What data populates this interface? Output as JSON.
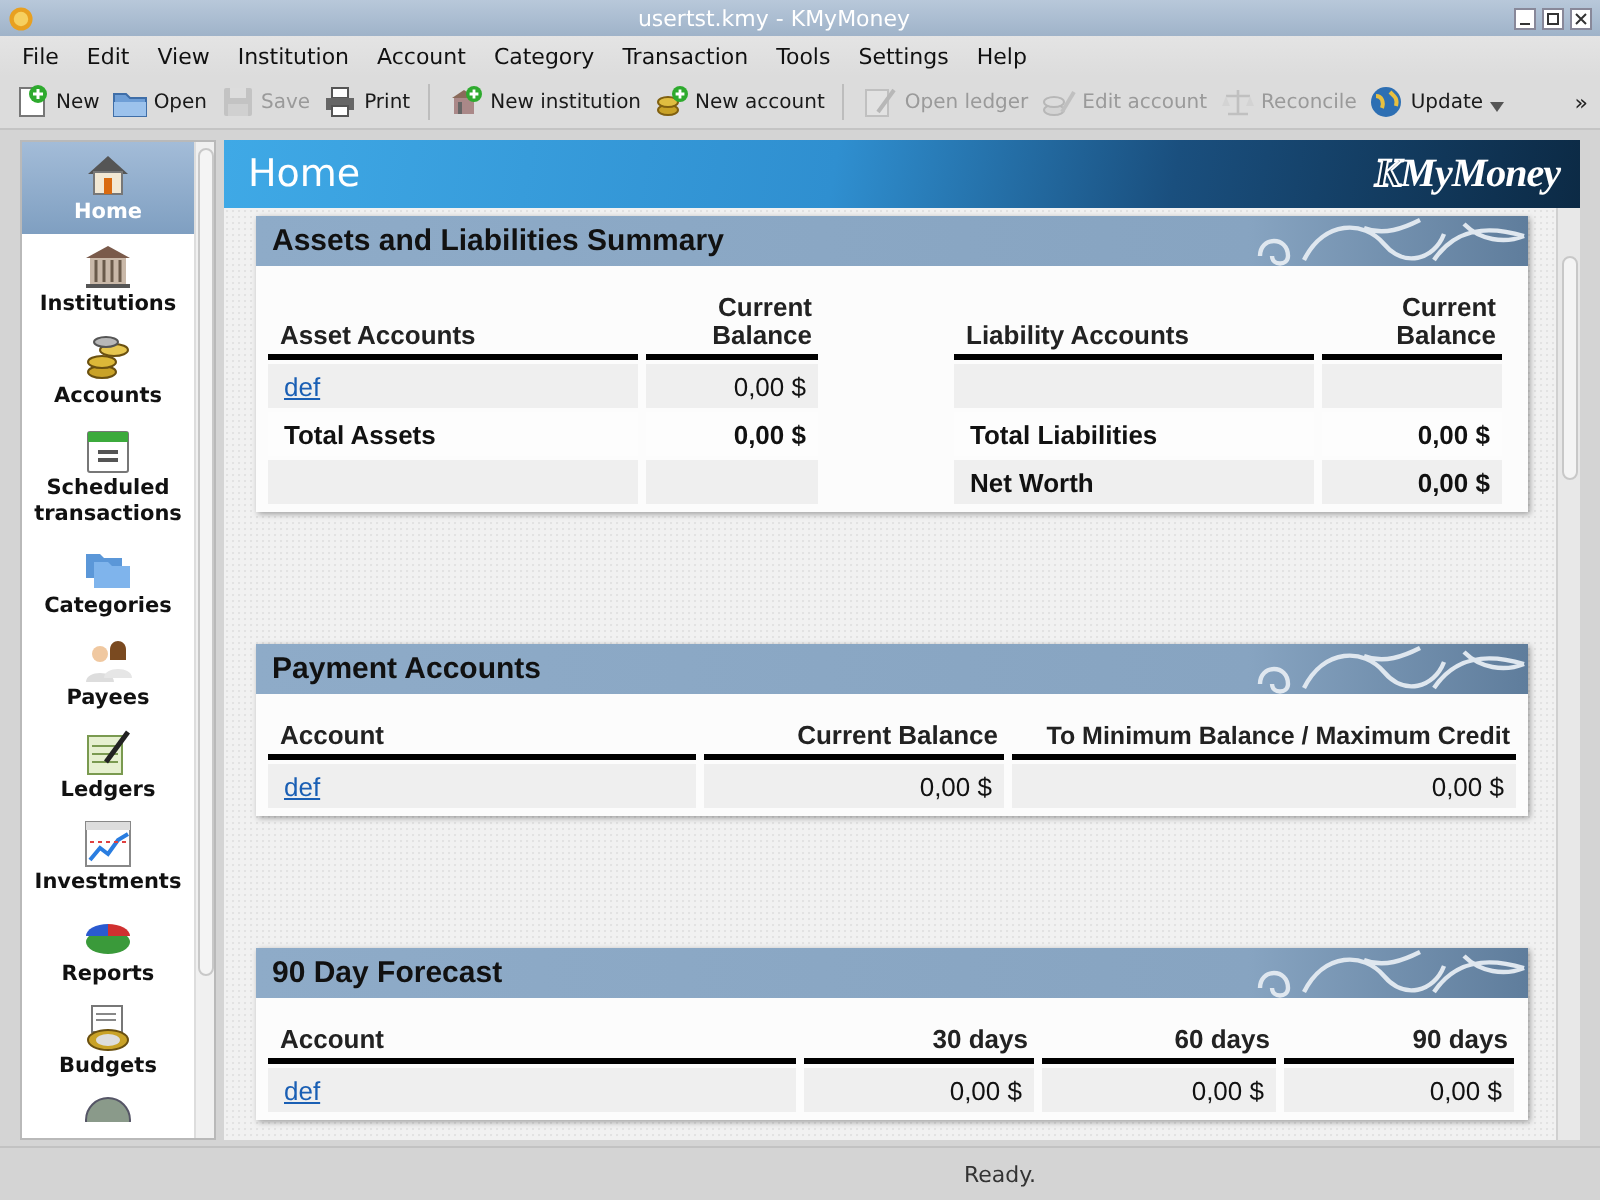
{
  "window": {
    "title": "usertst.kmy - KMyMoney"
  },
  "menu": [
    "File",
    "Edit",
    "View",
    "Institution",
    "Account",
    "Category",
    "Transaction",
    "Tools",
    "Settings",
    "Help"
  ],
  "toolbar": {
    "items": [
      {
        "kind": "button",
        "label": "New",
        "disabled": false
      },
      {
        "kind": "button",
        "label": "Open",
        "disabled": false
      },
      {
        "kind": "button",
        "label": "Save",
        "disabled": true
      },
      {
        "kind": "button",
        "label": "Print",
        "disabled": false
      },
      {
        "kind": "separator"
      },
      {
        "kind": "button",
        "label": "New institution",
        "disabled": false
      },
      {
        "kind": "button",
        "label": "New account",
        "disabled": false
      },
      {
        "kind": "separator"
      },
      {
        "kind": "button",
        "label": "Open ledger",
        "disabled": true
      },
      {
        "kind": "button",
        "label": "Edit account",
        "disabled": true
      },
      {
        "kind": "button",
        "label": "Reconcile",
        "disabled": true
      },
      {
        "kind": "menu_button",
        "label": "Update",
        "disabled": false
      }
    ],
    "overflow": "»"
  },
  "sidebar": {
    "items": [
      {
        "label": "Home",
        "selected": true
      },
      {
        "label": "Institutions",
        "selected": false
      },
      {
        "label": "Accounts",
        "selected": false
      },
      {
        "label": "Scheduled transactions",
        "selected": false
      },
      {
        "label": "Categories",
        "selected": false
      },
      {
        "label": "Payees",
        "selected": false
      },
      {
        "label": "Ledgers",
        "selected": false
      },
      {
        "label": "Investments",
        "selected": false
      },
      {
        "label": "Reports",
        "selected": false
      },
      {
        "label": "Budgets",
        "selected": false
      }
    ]
  },
  "page": {
    "title": "Home",
    "logo": "MyMoney",
    "logo_initial": "K"
  },
  "sections": [
    {
      "kind": "summary",
      "title": "Assets and Liabilities Summary",
      "columns": [
        "Asset Accounts",
        "Current Balance",
        "Liability Accounts",
        "Current Balance"
      ],
      "rows": [
        [
          {
            "kind": "link",
            "text": "def"
          },
          {
            "kind": "text",
            "text": "0,00 $"
          },
          {
            "kind": "empty"
          },
          {
            "kind": "empty"
          }
        ],
        [
          {
            "kind": "total",
            "text": "Total Assets"
          },
          {
            "kind": "total",
            "text": "0,00 $"
          },
          {
            "kind": "total",
            "text": "Total Liabilities"
          },
          {
            "kind": "total",
            "text": "0,00 $"
          }
        ],
        [
          {
            "kind": "empty"
          },
          {
            "kind": "empty"
          },
          {
            "kind": "total",
            "text": "Net Worth"
          },
          {
            "kind": "total",
            "text": "0,00 $"
          }
        ]
      ]
    },
    {
      "kind": "payment",
      "title": "Payment Accounts",
      "columns": [
        "Account",
        "Current Balance",
        "To Minimum Balance / Maximum Credit"
      ],
      "rows": [
        [
          {
            "kind": "link",
            "text": "def"
          },
          {
            "kind": "text",
            "text": "0,00 $"
          },
          {
            "kind": "text",
            "text": "0,00 $"
          }
        ]
      ]
    },
    {
      "kind": "forecast",
      "title": "90 Day Forecast",
      "columns": [
        "Account",
        "30 days",
        "60 days",
        "90 days"
      ],
      "rows": [
        [
          {
            "kind": "link",
            "text": "def"
          },
          {
            "kind": "text",
            "text": "0,00 $"
          },
          {
            "kind": "text",
            "text": "0,00 $"
          },
          {
            "kind": "text",
            "text": "0,00 $"
          }
        ]
      ]
    }
  ],
  "status_bar": {
    "text": "Ready."
  }
}
